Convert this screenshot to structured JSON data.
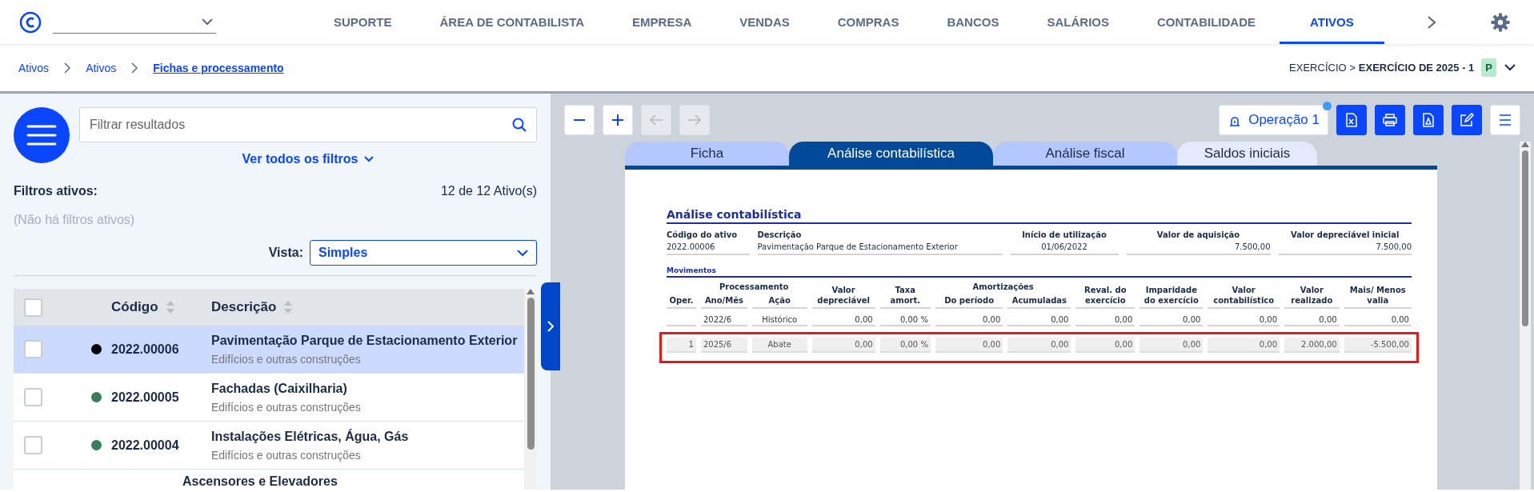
{
  "nav": {
    "items": [
      {
        "label": "SUPORTE",
        "selected": false
      },
      {
        "label": "ÁREA DE CONTABILISTA",
        "selected": false
      },
      {
        "label": "EMPRESA",
        "selected": false
      },
      {
        "label": "VENDAS",
        "selected": false
      },
      {
        "label": "COMPRAS",
        "selected": false
      },
      {
        "label": "BANCOS",
        "selected": false
      },
      {
        "label": "SALÁRIOS",
        "selected": false
      },
      {
        "label": "CONTABILIDADE",
        "selected": false
      },
      {
        "label": "ATIVOS",
        "selected": true
      }
    ]
  },
  "breadcrumb": [
    "Ativos",
    "Ativos",
    "Fichas e processamento"
  ],
  "exercise": {
    "label": "EXERCÍCIO >",
    "value": "EXERCÍCIO DE 2025 - 1",
    "badge": "P"
  },
  "sidebar": {
    "search": {
      "placeholder": "Filtrar resultados"
    },
    "filters_link": "Ver todos os filtros",
    "active_filters_label": "Filtros ativos:",
    "count": "12 de 12 Ativo(s)",
    "no_filters": "(Não há filtros ativos)",
    "view_label": "Vista:",
    "view_value": "Simples",
    "table": {
      "select_all": {
        "checked": false
      },
      "columns": [
        "Código",
        "Descrição"
      ],
      "rows": [
        {
          "code": "2022.00006",
          "description": "Pavimentação Parque de Estacionamento Exterior",
          "category": "Edifícios e outras construções",
          "color": "#000000",
          "checked": false,
          "selected": true
        },
        {
          "code": "2022.00005",
          "description": "Fachadas (Caixilharia)",
          "category": "Edifícios e outras construções",
          "color": "#3a7d5c",
          "checked": false,
          "selected": false
        },
        {
          "code": "2022.00004",
          "description": "Instalações Elétricas, Água, Gás",
          "category": "Edifícios e outras construções",
          "color": "#3a7d5c",
          "checked": false,
          "selected": false
        },
        {
          "description": "Ascensores e Elevadores",
          "selected": false
        }
      ]
    }
  },
  "toolbar": {
    "operation": "Operação 1"
  },
  "doc_tabs": [
    {
      "label": "Ficha",
      "selected": false
    },
    {
      "label": "Análise contabilística",
      "selected": true
    },
    {
      "label": "Análise fiscal",
      "selected": false
    },
    {
      "label": "Saldos iniciais",
      "selected": false
    }
  ],
  "document": {
    "title": "Análise contabilística",
    "fields": [
      {
        "label": "Código do ativo",
        "value": "2022.00006"
      },
      {
        "label": "Descrição",
        "value": "Pavimentação Parque de Estacionamento Exterior"
      },
      {
        "label": "Início de utilização",
        "value": "01/06/2022"
      },
      {
        "label": "Valor de aquisição",
        "value": "7.500,00"
      },
      {
        "label": "Valor depreciável inicial",
        "value": "7.500,00"
      }
    ],
    "movements_title": "Movimentos",
    "groups": [
      "Processamento",
      "Amortizações"
    ],
    "columns": [
      "Oper.",
      "Ano/Mês",
      "Ação",
      "Valor depreciável",
      "Taxa amort.",
      "Do período",
      "Acumuladas",
      "Reval. do exercício",
      "Imparidade do exercício",
      "Valor contabilístico",
      "Valor realizado",
      "Mais/ Menos valia"
    ],
    "rows": [
      {
        "kind": "history",
        "highlighted": false,
        "cells": [
          "",
          "2022/6",
          "Histórico",
          "0,00",
          "0,00 %",
          "0,00",
          "0,00",
          "0,00",
          "0,00",
          "0,00",
          "0,00",
          "0,00"
        ]
      },
      {
        "kind": "entry",
        "highlighted": true,
        "cells": [
          "1",
          "2025/6",
          "Abate",
          "0,00",
          "0,00 %",
          "0,00",
          "0,00",
          "0,00",
          "0,00",
          "0,00",
          "2.000,00",
          "-5.500,00"
        ]
      }
    ]
  }
}
